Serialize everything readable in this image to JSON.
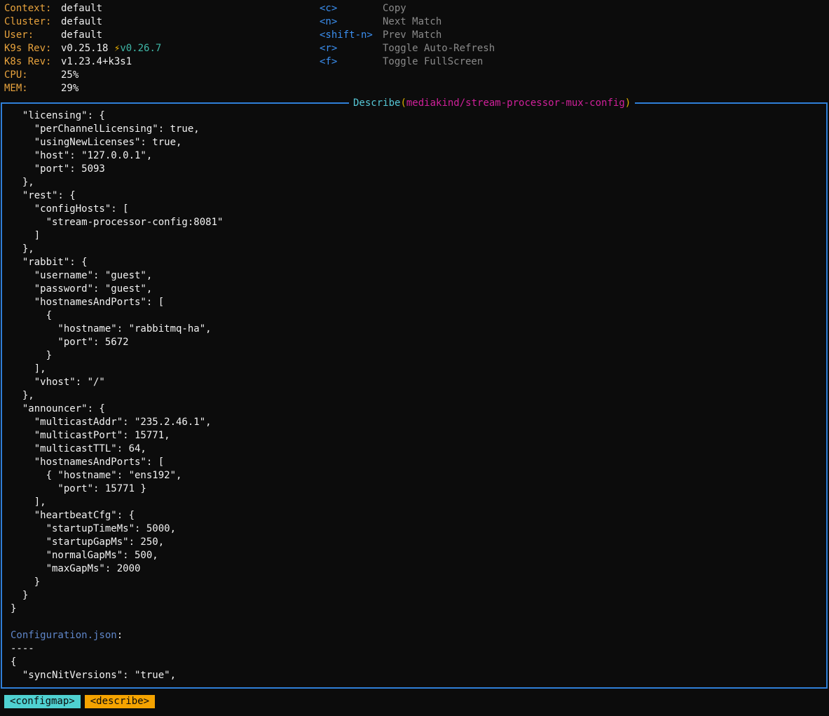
{
  "header": {
    "info": [
      {
        "key": "Context:",
        "value": "default"
      },
      {
        "key": "Cluster:",
        "value": "default"
      },
      {
        "key": "User:",
        "value": "default"
      },
      {
        "key": "K9s Rev:",
        "value": "v0.25.18",
        "bolt": "⚡",
        "new_value": "v0.26.7"
      },
      {
        "key": "K8s Rev:",
        "value": "v1.23.4+k3s1"
      },
      {
        "key": "CPU:",
        "value": "25%"
      },
      {
        "key": "MEM:",
        "value": "29%"
      }
    ],
    "hints": [
      {
        "key": "<c>",
        "label": "Copy"
      },
      {
        "key": "<n>",
        "label": "Next Match"
      },
      {
        "key": "<shift-n>",
        "label": "Prev Match"
      },
      {
        "key": "<r>",
        "label": "Toggle Auto-Refresh"
      },
      {
        "key": "<f>",
        "label": "Toggle FullScreen"
      }
    ]
  },
  "panel": {
    "title_word": "Describe",
    "open_paren": "(",
    "resource": "mediakind/stream-processor-mux-config",
    "close_paren": ")",
    "border_color": "#2f7fd8"
  },
  "content": {
    "lines": [
      "  \"licensing\": {",
      "    \"perChannelLicensing\": true,",
      "    \"usingNewLicenses\": true,",
      "    \"host\": \"127.0.0.1\",",
      "    \"port\": 5093",
      "  },",
      "  \"rest\": {",
      "    \"configHosts\": [",
      "      \"stream-processor-config:8081\"",
      "    ]",
      "  },",
      "  \"rabbit\": {",
      "    \"username\": \"guest\",",
      "    \"password\": \"guest\",",
      "    \"hostnamesAndPorts\": [",
      "      {",
      "        \"hostname\": \"rabbitmq-ha\",",
      "        \"port\": 5672",
      "      }",
      "    ],",
      "    \"vhost\": \"/\"",
      "  },",
      "  \"announcer\": {",
      "    \"multicastAddr\": \"235.2.46.1\",",
      "    \"multicastPort\": 15771,",
      "    \"multicastTTL\": 64,",
      "    \"hostnamesAndPorts\": [",
      "      { \"hostname\": \"ens192\",",
      "        \"port\": 15771 }",
      "    ],",
      "    \"heartbeatCfg\": {",
      "      \"startupTimeMs\": 5000,",
      "      \"startupGapMs\": 250,",
      "      \"normalGapMs\": 500,",
      "      \"maxGapMs\": 2000",
      "    }",
      "  }",
      "}",
      "",
      "",
      "----",
      "{",
      "  \"syncNitVersions\": \"true\","
    ],
    "file_label": "Configuration.json",
    "file_colon": ":"
  },
  "footer": {
    "crumbs": [
      {
        "label": "<configmap>",
        "color": "#4fd1d1"
      },
      {
        "label": "<describe>",
        "color": "#f5a300"
      }
    ]
  }
}
